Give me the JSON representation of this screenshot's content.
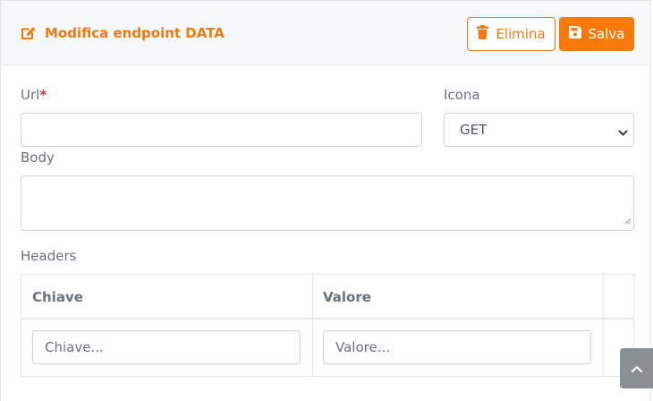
{
  "header": {
    "title": "Modifica endpoint DATA",
    "title_icon": "edit-icon",
    "delete_label": "Elimina",
    "delete_icon": "trash-icon",
    "save_label": "Salva",
    "save_icon": "floppy-disk-icon"
  },
  "form": {
    "url_label": "Url",
    "url_required_mark": "*",
    "url_value": "",
    "icon_label": "Icona",
    "icon_selected": "GET",
    "body_label": "Body",
    "body_value": "",
    "headers_label": "Headers"
  },
  "headers_table": {
    "columns": [
      "Chiave",
      "Valore",
      ""
    ],
    "rows": [
      {
        "key_placeholder": "Chiave...",
        "value_placeholder": "Valore..."
      }
    ]
  },
  "colors": {
    "accent": "#f97a0b",
    "required": "#d6303f",
    "header_bg": "#f7f8fa",
    "scroll_button": "#8a8f94"
  },
  "scroll_button_icon": "chevron-up-icon"
}
